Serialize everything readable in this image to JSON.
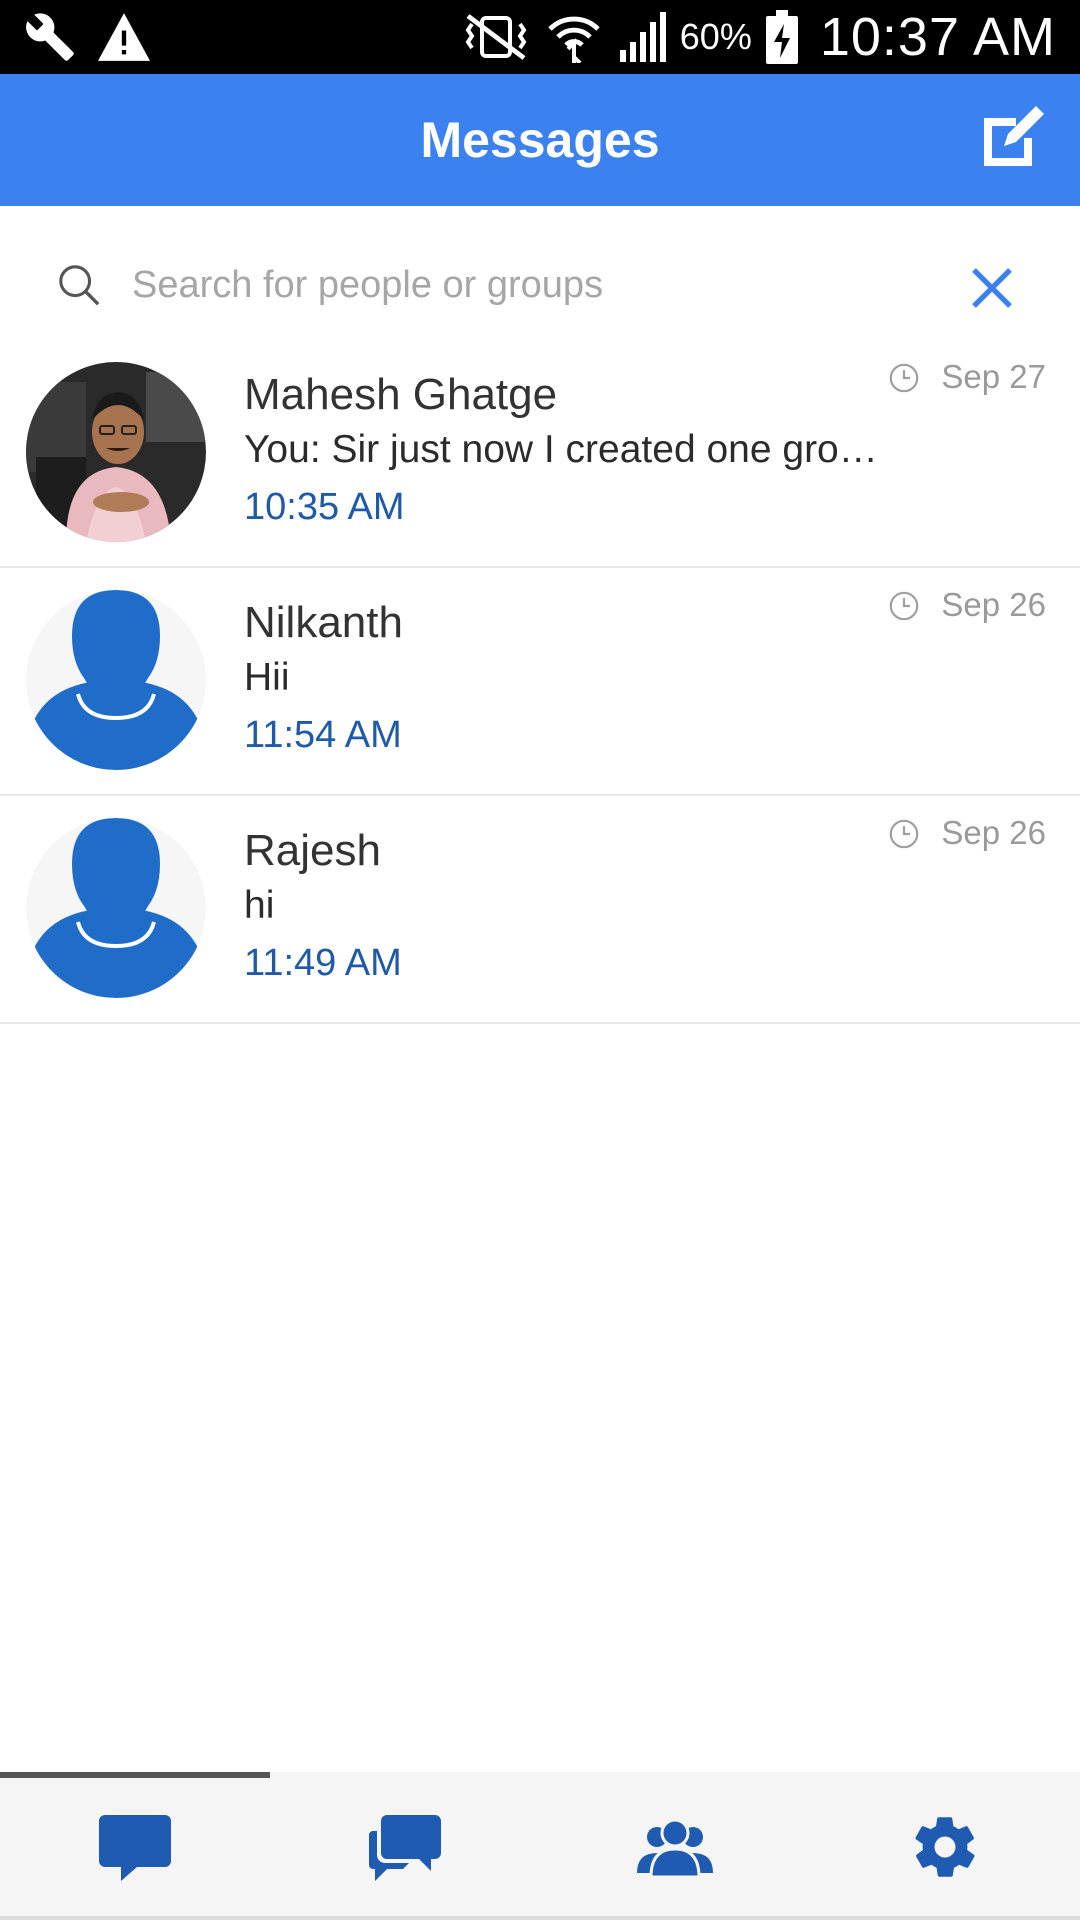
{
  "status_bar": {
    "battery_percent": "60%",
    "time": "10:37 AM",
    "icons": [
      "wrench-icon",
      "warning-icon",
      "vibrate-off-icon",
      "wifi-icon",
      "signal-icon",
      "battery-charging-icon"
    ]
  },
  "header": {
    "title": "Messages",
    "compose_icon": "compose-icon"
  },
  "search": {
    "placeholder": "Search for people or groups",
    "value": ""
  },
  "conversations": [
    {
      "name": "Mahesh Ghatge",
      "message": "You: Sir just now I created one gro…",
      "time": "10:35 AM",
      "date": "Sep 27",
      "avatar": "photo"
    },
    {
      "name": "Nilkanth",
      "message": "Hii",
      "time": "11:54 AM",
      "date": "Sep 26",
      "avatar": "default-person"
    },
    {
      "name": "Rajesh",
      "message": "hi",
      "time": "11:49 AM",
      "date": "Sep 26",
      "avatar": "default-person"
    }
  ],
  "bottom_nav": {
    "tabs": [
      "chat-icon",
      "group-chat-icon",
      "contacts-icon",
      "settings-icon"
    ],
    "active_index": 0
  },
  "colors": {
    "accent": "#3b82f0",
    "nav_icon": "#1f5bb0",
    "time_text": "#1e5aa8"
  }
}
